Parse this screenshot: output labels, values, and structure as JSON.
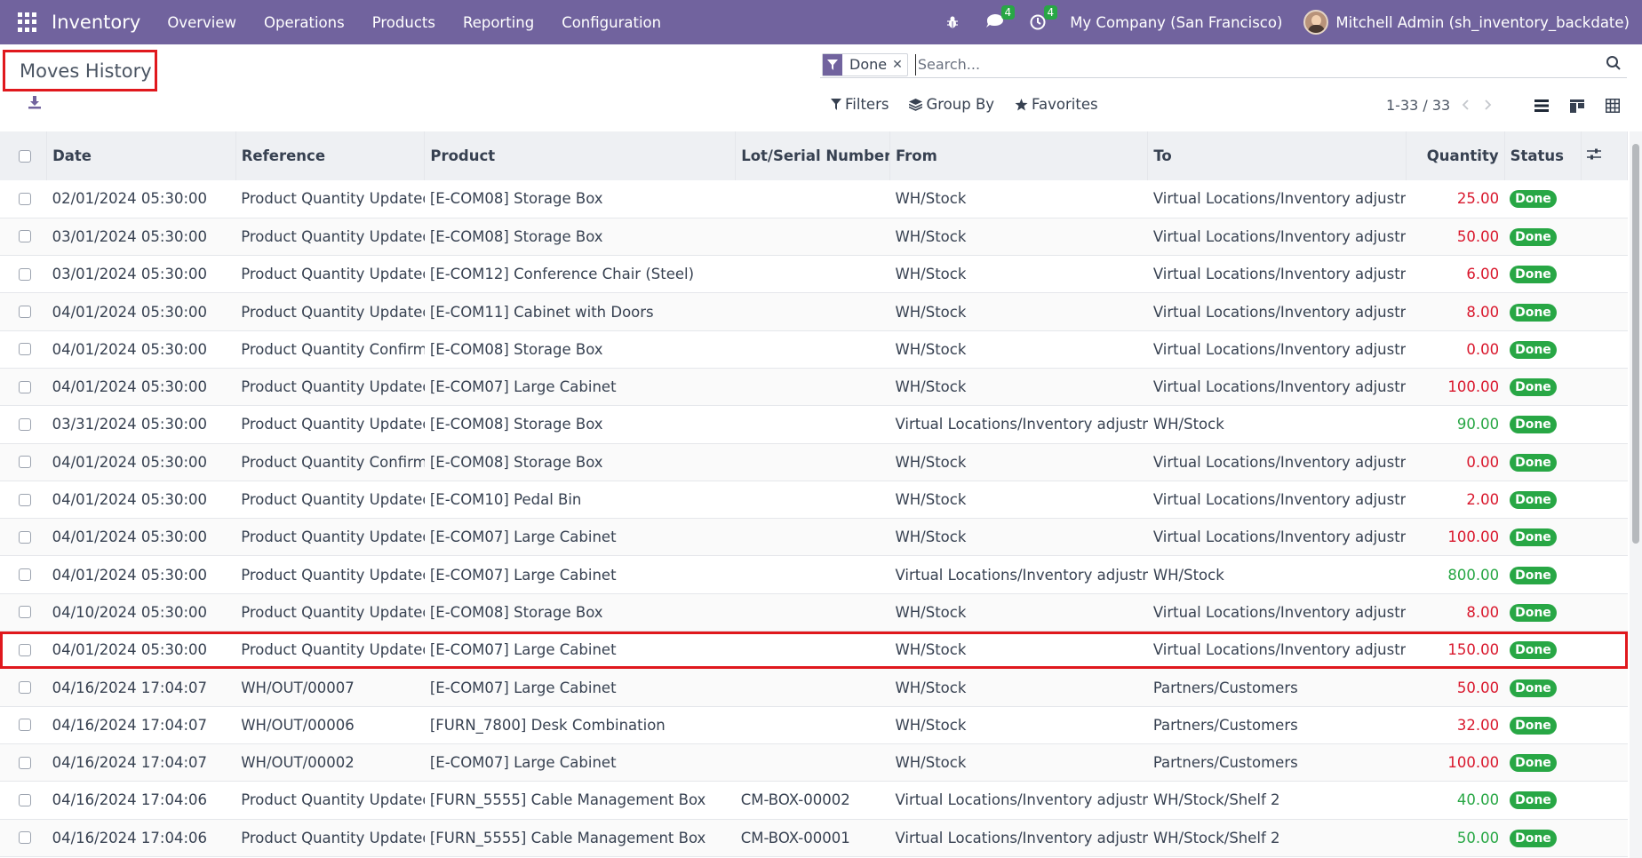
{
  "navbar": {
    "app_name": "Inventory",
    "menu": [
      "Overview",
      "Operations",
      "Products",
      "Reporting",
      "Configuration"
    ],
    "messages_count": "4",
    "activities_count": "4",
    "company": "My Company (San Francisco)",
    "user": "Mitchell Admin (sh_inventory_backdate)",
    "bg_color": "#71639e"
  },
  "page": {
    "title": "Moves History"
  },
  "search": {
    "facet_label": "Done",
    "placeholder": "Search..."
  },
  "filters": {
    "filters_label": "Filters",
    "group_by_label": "Group By",
    "favorites_label": "Favorites"
  },
  "pager": {
    "text": "1-33 / 33"
  },
  "table": {
    "columns": [
      "Date",
      "Reference",
      "Product",
      "Lot/Serial Number",
      "From",
      "To",
      "Quantity",
      "Status"
    ],
    "rows": [
      {
        "date": "02/01/2024 05:30:00",
        "reference": "Product Quantity Updated",
        "product": "[E-COM08] Storage Box",
        "lot": "",
        "from": "WH/Stock",
        "to": "Virtual Locations/Inventory adjustment",
        "qty": "25.00",
        "qty_color": "red",
        "status": "Done"
      },
      {
        "date": "03/01/2024 05:30:00",
        "reference": "Product Quantity Updated",
        "product": "[E-COM08] Storage Box",
        "lot": "",
        "from": "WH/Stock",
        "to": "Virtual Locations/Inventory adjustment",
        "qty": "50.00",
        "qty_color": "red",
        "status": "Done"
      },
      {
        "date": "03/01/2024 05:30:00",
        "reference": "Product Quantity Updated",
        "product": "[E-COM12] Conference Chair (Steel)",
        "lot": "",
        "from": "WH/Stock",
        "to": "Virtual Locations/Inventory adjustment",
        "qty": "6.00",
        "qty_color": "red",
        "status": "Done"
      },
      {
        "date": "04/01/2024 05:30:00",
        "reference": "Product Quantity Updated",
        "product": "[E-COM11] Cabinet with Doors",
        "lot": "",
        "from": "WH/Stock",
        "to": "Virtual Locations/Inventory adjustment",
        "qty": "8.00",
        "qty_color": "red",
        "status": "Done"
      },
      {
        "date": "04/01/2024 05:30:00",
        "reference": "Product Quantity Confirmed",
        "product": "[E-COM08] Storage Box",
        "lot": "",
        "from": "WH/Stock",
        "to": "Virtual Locations/Inventory adjustment",
        "qty": "0.00",
        "qty_color": "red",
        "status": "Done"
      },
      {
        "date": "04/01/2024 05:30:00",
        "reference": "Product Quantity Updated",
        "product": "[E-COM07] Large Cabinet",
        "lot": "",
        "from": "WH/Stock",
        "to": "Virtual Locations/Inventory adjustment",
        "qty": "100.00",
        "qty_color": "red",
        "status": "Done"
      },
      {
        "date": "03/31/2024 05:30:00",
        "reference": "Product Quantity Updated",
        "product": "[E-COM08] Storage Box",
        "lot": "",
        "from": "Virtual Locations/Inventory adjustment",
        "to": "WH/Stock",
        "qty": "90.00",
        "qty_color": "green",
        "status": "Done"
      },
      {
        "date": "04/01/2024 05:30:00",
        "reference": "Product Quantity Confirmed",
        "product": "[E-COM08] Storage Box",
        "lot": "",
        "from": "WH/Stock",
        "to": "Virtual Locations/Inventory adjustment",
        "qty": "0.00",
        "qty_color": "red",
        "status": "Done"
      },
      {
        "date": "04/01/2024 05:30:00",
        "reference": "Product Quantity Updated",
        "product": "[E-COM10] Pedal Bin",
        "lot": "",
        "from": "WH/Stock",
        "to": "Virtual Locations/Inventory adjustment",
        "qty": "2.00",
        "qty_color": "red",
        "status": "Done"
      },
      {
        "date": "04/01/2024 05:30:00",
        "reference": "Product Quantity Updated",
        "product": "[E-COM07] Large Cabinet",
        "lot": "",
        "from": "WH/Stock",
        "to": "Virtual Locations/Inventory adjustment",
        "qty": "100.00",
        "qty_color": "red",
        "status": "Done"
      },
      {
        "date": "04/01/2024 05:30:00",
        "reference": "Product Quantity Updated",
        "product": "[E-COM07] Large Cabinet",
        "lot": "",
        "from": "Virtual Locations/Inventory adjustment",
        "to": "WH/Stock",
        "qty": "800.00",
        "qty_color": "green",
        "status": "Done"
      },
      {
        "date": "04/10/2024 05:30:00",
        "reference": "Product Quantity Updated",
        "product": "[E-COM08] Storage Box",
        "lot": "",
        "from": "WH/Stock",
        "to": "Virtual Locations/Inventory adjustment",
        "qty": "8.00",
        "qty_color": "red",
        "status": "Done"
      },
      {
        "date": "04/01/2024 05:30:00",
        "reference": "Product Quantity Updated",
        "product": "[E-COM07] Large Cabinet",
        "lot": "",
        "from": "WH/Stock",
        "to": "Virtual Locations/Inventory adjustment",
        "qty": "150.00",
        "qty_color": "red",
        "status": "Done",
        "highlight": true
      },
      {
        "date": "04/16/2024 17:04:07",
        "reference": "WH/OUT/00007",
        "product": "[E-COM07] Large Cabinet",
        "lot": "",
        "from": "WH/Stock",
        "to": "Partners/Customers",
        "qty": "50.00",
        "qty_color": "red",
        "status": "Done"
      },
      {
        "date": "04/16/2024 17:04:07",
        "reference": "WH/OUT/00006",
        "product": "[FURN_7800] Desk Combination",
        "lot": "",
        "from": "WH/Stock",
        "to": "Partners/Customers",
        "qty": "32.00",
        "qty_color": "red",
        "status": "Done"
      },
      {
        "date": "04/16/2024 17:04:07",
        "reference": "WH/OUT/00002",
        "product": "[E-COM07] Large Cabinet",
        "lot": "",
        "from": "WH/Stock",
        "to": "Partners/Customers",
        "qty": "100.00",
        "qty_color": "red",
        "status": "Done"
      },
      {
        "date": "04/16/2024 17:04:06",
        "reference": "Product Quantity Updated",
        "product": "[FURN_5555] Cable Management Box",
        "lot": "CM-BOX-00002",
        "from": "Virtual Locations/Inventory adjustment",
        "to": "WH/Stock/Shelf 2",
        "qty": "40.00",
        "qty_color": "green",
        "status": "Done"
      },
      {
        "date": "04/16/2024 17:04:06",
        "reference": "Product Quantity Updated",
        "product": "[FURN_5555] Cable Management Box",
        "lot": "CM-BOX-00001",
        "from": "Virtual Locations/Inventory adjustment",
        "to": "WH/Stock/Shelf 2",
        "qty": "50.00",
        "qty_color": "green",
        "status": "Done"
      }
    ]
  }
}
